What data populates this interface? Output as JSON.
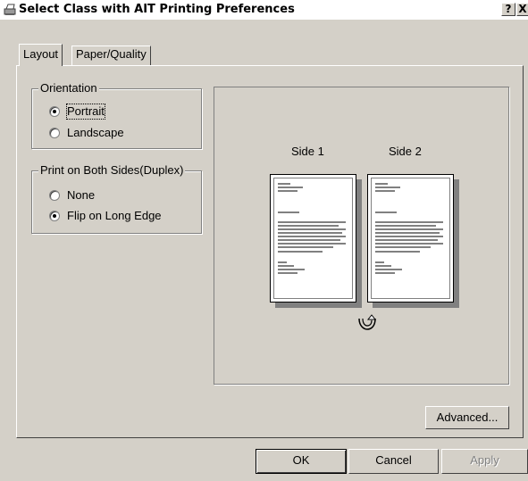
{
  "window": {
    "title": "Select Class with AIT Printing Preferences",
    "help_glyph": "?",
    "close_glyph": "X"
  },
  "tabs": [
    {
      "label": "Layout",
      "active": true
    },
    {
      "label": "Paper/Quality",
      "active": false
    }
  ],
  "orientation": {
    "label": "Orientation",
    "options": [
      {
        "label": "Portrait",
        "selected": true
      },
      {
        "label": "Landscape",
        "selected": false
      }
    ]
  },
  "duplex": {
    "label": "Print on Both Sides(Duplex)",
    "options": [
      {
        "label": "None",
        "selected": false
      },
      {
        "label": "Flip on Long Edge",
        "selected": true
      }
    ]
  },
  "preview": {
    "side1_label": "Side 1",
    "side2_label": "Side 2",
    "flip_icon": "flip-arrow-icon"
  },
  "buttons": {
    "advanced": "Advanced...",
    "ok": "OK",
    "cancel": "Cancel",
    "apply": "Apply"
  },
  "colors": {
    "dialog_bg": "#d4d0c8",
    "shadow": "#808080",
    "disabled_text": "#808080"
  }
}
